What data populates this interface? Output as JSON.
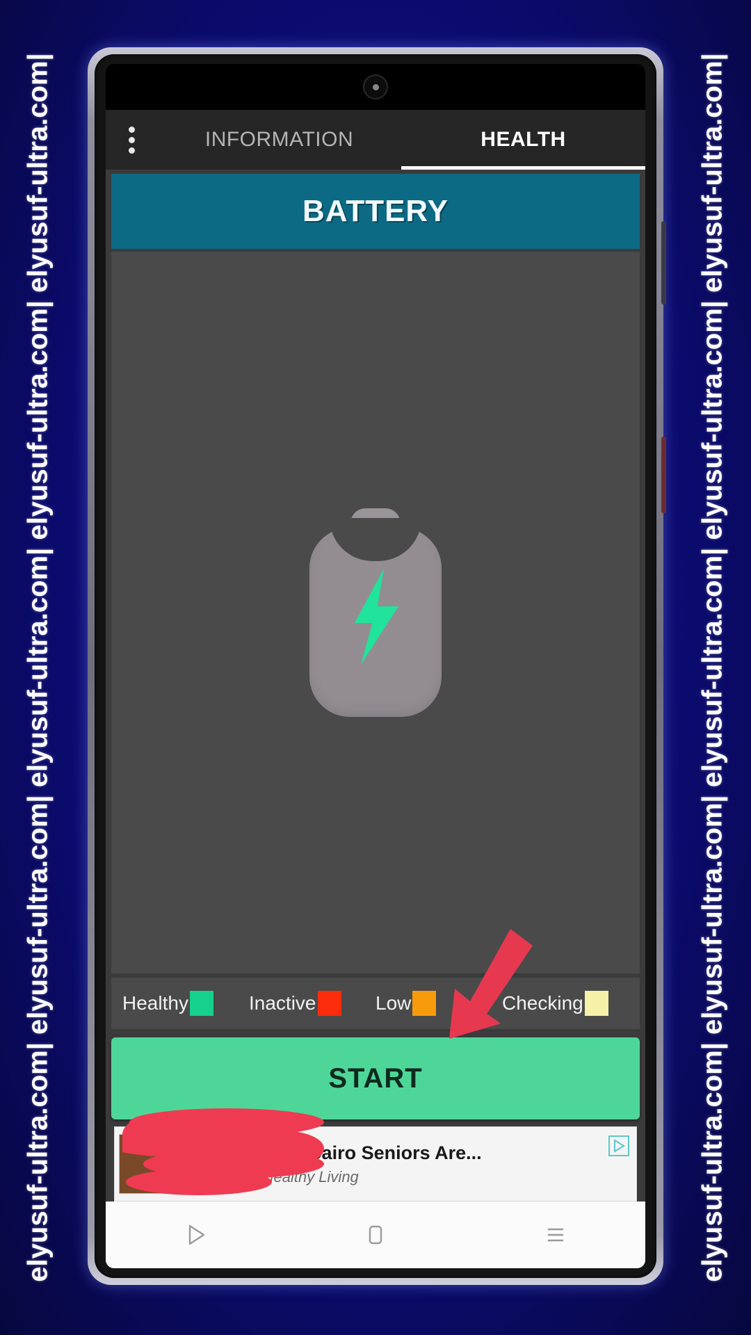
{
  "watermark": {
    "text": "elyusuf-ultra.com| elyusuf-ultra.com| elyusuf-ultra.com| elyusuf-ultra.com| elyusuf-ultra.com|",
    "color": "#ffffff",
    "background": "#101075"
  },
  "statusbar": {
    "camera_icon": "front-camera"
  },
  "tabs": {
    "overflow_label": "more-options",
    "items": [
      {
        "label": "INFORMATION",
        "active": false
      },
      {
        "label": "HEALTH",
        "active": true
      }
    ]
  },
  "banner": {
    "title": "BATTERY",
    "color": "#0d6a85"
  },
  "battery_icon": {
    "name": "battery-charging-icon",
    "body_color": "#938d92",
    "bolt_color": "#21e39b"
  },
  "legend": {
    "items": [
      {
        "label": "Healthy",
        "color": "#15d18b"
      },
      {
        "label": "Inactive",
        "color": "#fc2d0d"
      },
      {
        "label": "Low",
        "color": "#f79b0b"
      },
      {
        "label": "Checking",
        "color": "#f6f1a8"
      }
    ]
  },
  "start_button": {
    "label": "START",
    "color": "#4ed699",
    "text_color": "#0d2a1e"
  },
  "ad": {
    "title": "red Saunas: Cairo Seniors Are...",
    "subtitle": "sored by: Healthy Living",
    "adchoices_icon": "adchoices-icon"
  },
  "navbar": {
    "items": [
      {
        "icon": "back-triangle-icon"
      },
      {
        "icon": "home-square-icon"
      },
      {
        "icon": "recents-menu-icon"
      }
    ]
  },
  "annotations": {
    "arrow": {
      "name": "red-arrow-pointing-to-start",
      "color": "#e63950"
    },
    "scribble": {
      "name": "red-scribble-redaction",
      "color": "#ef3b52"
    }
  }
}
